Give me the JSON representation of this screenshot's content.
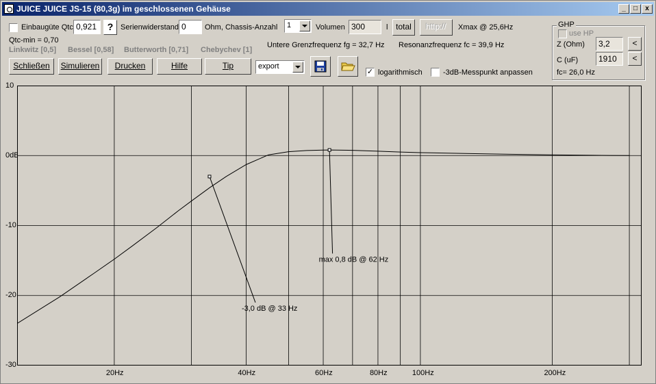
{
  "window": {
    "title": "JUICE JUICE JS-15 (80,3g) im geschlossenen Gehäuse",
    "buttons": {
      "minimize": "_",
      "maximize": "□",
      "close": "x"
    }
  },
  "controls": {
    "einbau_label": "Einbaugüte Qtc",
    "einbau_checked": false,
    "qtc_value": "0,921",
    "qtc_help": "?",
    "serien_label": "Serienwiderstand",
    "serien_value": "0",
    "ohm_chassis_label": "Ohm, Chassis-Anzahl",
    "chassis_count": "1",
    "volumen_label": "Volumen",
    "volumen_value": "300",
    "liter_unit": "l",
    "total_button": "total",
    "http_button": "http://",
    "xmax_text": "Xmax @ 25,6Hz",
    "qtc_min": "Qtc-min = 0,70",
    "presets": [
      "Linkwitz [0,5]",
      "Bessel [0,58]",
      "Butterworth [0,71]",
      "Chebychev [1]"
    ],
    "fg_text": "Untere Grenzfrequenz fg = 32,7 Hz",
    "fc_text": "Resonanzfrequenz fc = 39,9 Hz",
    "buttons": {
      "schliessen": "Schließen",
      "simulieren": "Simulieren",
      "drucken": "Drucken",
      "hilfe": "Hilfe",
      "tip": "Tip"
    },
    "export_select": "export",
    "log_label": "logarithmisch",
    "log_checked": true,
    "db3_label": "-3dB-Messpunkt anpassen",
    "db3_checked": false
  },
  "ghp": {
    "title": "GHP",
    "use_hp_label": "use HP",
    "use_hp_checked": false,
    "z_label": "Z (Ohm)",
    "z_value": "3,2",
    "c_label": "C (uF)",
    "c_value": "1910",
    "fc_text": "fc= 26,0 Hz",
    "btn_top": "<",
    "btn_bottom": "<"
  },
  "chart_data": {
    "type": "line",
    "x_scale": "log",
    "xlim": [
      12,
      320
    ],
    "ylim": [
      -30,
      10
    ],
    "grid": true,
    "y_ticks": [
      10,
      0,
      -10,
      -20,
      -30
    ],
    "y_tick_labels": [
      "10",
      "0dB",
      "-10",
      "-20",
      "-30"
    ],
    "x_gridlines": [
      20,
      30,
      40,
      50,
      60,
      70,
      80,
      90,
      100,
      200,
      300
    ],
    "x_tick_labels": [
      {
        "x": 20,
        "label": "20Hz"
      },
      {
        "x": 40,
        "label": "40Hz"
      },
      {
        "x": 60,
        "label": "60Hz"
      },
      {
        "x": 80,
        "label": "80Hz"
      },
      {
        "x": 100,
        "label": "100Hz"
      },
      {
        "x": 200,
        "label": "200Hz"
      }
    ],
    "series": [
      {
        "x": [
          12,
          15,
          18,
          20,
          22,
          25,
          28,
          30,
          33,
          36,
          40,
          45,
          50,
          55,
          60,
          62,
          70,
          80,
          90,
          100,
          130,
          160,
          200,
          250,
          300
        ],
        "y": [
          -24,
          -20.2,
          -16.8,
          -14.8,
          -12.9,
          -10.3,
          -7.9,
          -6.5,
          -4.6,
          -3.0,
          -1.3,
          0.1,
          0.55,
          0.72,
          0.78,
          0.8,
          0.75,
          0.62,
          0.5,
          0.42,
          0.28,
          0.18,
          0.1,
          0.03,
          0.0
        ]
      }
    ],
    "annotations": [
      {
        "text": "-3,0 dB @ 33 Hz",
        "x": 33,
        "y": -3.0,
        "label_x": 42,
        "label_y": -21
      },
      {
        "text": "max 0,8 dB @ 62 Hz",
        "x": 62,
        "y": 0.8,
        "label_x": 63,
        "label_y": -14
      }
    ]
  }
}
